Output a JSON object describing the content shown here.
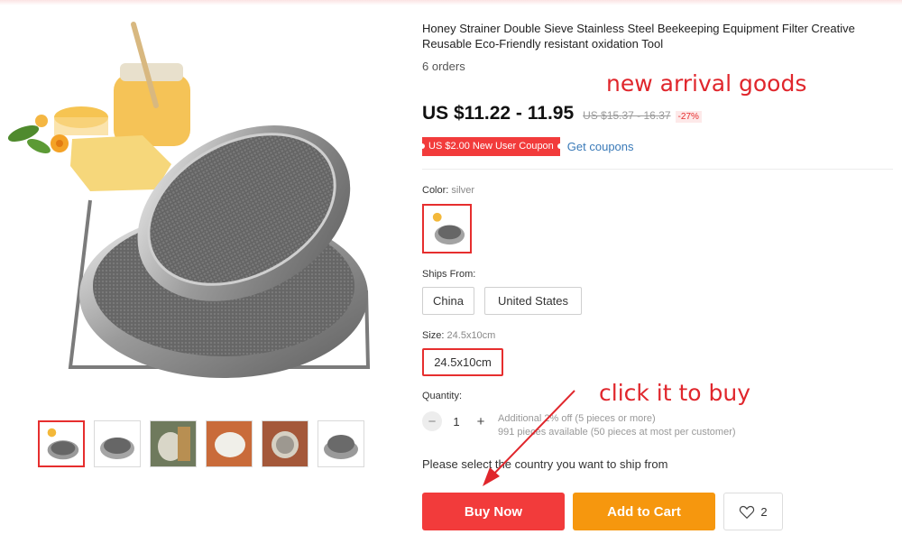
{
  "product": {
    "title": "Honey Strainer Double Sieve Stainless Steel Beekeeping Equipment Filter Creative Reusable Eco-Friendly resistant oxidation Tool",
    "orders": "6 orders",
    "price": "US $11.22 - 11.95",
    "old_price": "US $15.37 - 16.37",
    "discount": "-27%"
  },
  "coupon": {
    "badge": "US $2.00 New User Coupon",
    "link": "Get coupons"
  },
  "color": {
    "label": "Color:",
    "value": "silver"
  },
  "ships_from": {
    "label": "Ships From:",
    "options": [
      "China",
      "United States"
    ]
  },
  "size": {
    "label": "Size:",
    "value": "24.5x10cm",
    "options": [
      "24.5x10cm"
    ]
  },
  "quantity": {
    "label": "Quantity:",
    "minus": "−",
    "value": "1",
    "plus": "+",
    "note_line1": "Additional 2% off (5 pieces or more)",
    "note_line2": "991 pieces available (50 pieces at most per customer)"
  },
  "shipping_note": "Please select the country you want to ship from",
  "buttons": {
    "buy_now": "Buy Now",
    "add_to_cart": "Add to Cart",
    "wishlist_count": "2"
  },
  "annotations": {
    "new_arrival": "new arrival goods",
    "click_to_buy": "click it to buy"
  },
  "gallery": {
    "thumbnails": [
      "strainer-with-honey",
      "strainer-side",
      "strainer-in-use",
      "strainer-with-cloth",
      "strainer-on-table",
      "strainer-angle"
    ],
    "active_index": 0
  },
  "icons": {
    "wishlist": "heart-icon"
  },
  "colors": {
    "accent_red": "#f23b3b",
    "cart_orange": "#f6970e",
    "link_blue": "#3a7ab8",
    "annotation_red": "#e0262c"
  }
}
